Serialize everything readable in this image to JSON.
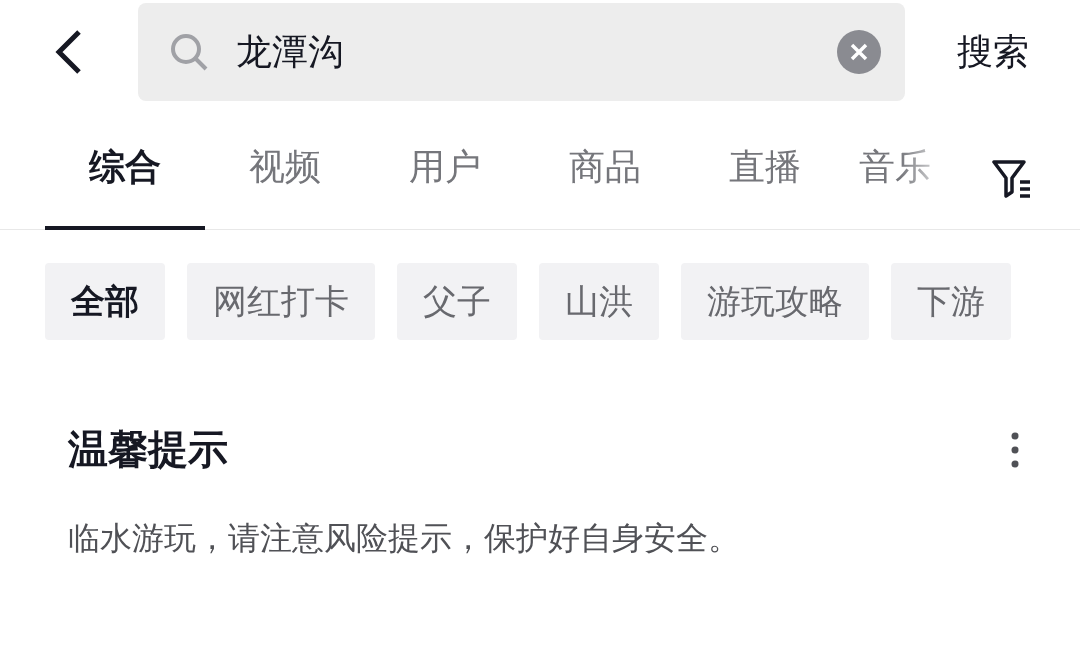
{
  "search": {
    "value": "龙潭沟",
    "submit": "搜索"
  },
  "tabs": [
    {
      "label": "综合",
      "selected": true
    },
    {
      "label": "视频",
      "selected": false
    },
    {
      "label": "用户",
      "selected": false
    },
    {
      "label": "商品",
      "selected": false
    },
    {
      "label": "直播",
      "selected": false
    },
    {
      "label": "音乐",
      "selected": false
    }
  ],
  "chips": [
    {
      "label": "全部",
      "selected": true
    },
    {
      "label": "网红打卡",
      "selected": false
    },
    {
      "label": "父子",
      "selected": false
    },
    {
      "label": "山洪",
      "selected": false
    },
    {
      "label": "游玩攻略",
      "selected": false
    },
    {
      "label": "下游",
      "selected": false
    }
  ],
  "notice": {
    "title": "温馨提示",
    "text": "临水游玩，请注意风险提示，保护好自身安全。"
  }
}
